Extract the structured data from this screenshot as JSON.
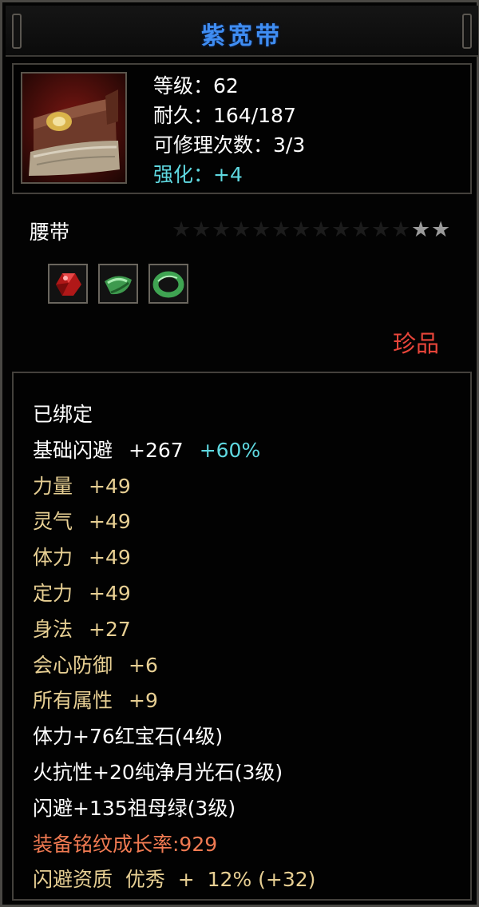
{
  "item": {
    "name": "紫宽带",
    "level_label": "等级：62",
    "durability_label": "耐久：164/187",
    "repair_label": "可修理次数：3/3",
    "enhance_label": "强化：+4",
    "type": "腰带",
    "stars_total": 14,
    "stars_lit": 2,
    "rarity": "珍品"
  },
  "icons": {
    "item_icon": "belt-icon",
    "gems": [
      "ruby-gem-icon",
      "jade-gem-icon",
      "emerald-ring-gem-icon"
    ]
  },
  "colors": {
    "title": "#3f8df2",
    "enhance": "#5fd8e0",
    "attribute": "#e7cf93",
    "rarity": "#e8453a",
    "growth": "#f07a52"
  },
  "attributes": {
    "bound": "已绑定",
    "base_dodge": {
      "label": "基础闪避",
      "value": "+267",
      "bonus": "+60%"
    },
    "stats": [
      {
        "label": "力量",
        "value": "+49"
      },
      {
        "label": "灵气",
        "value": "+49"
      },
      {
        "label": "体力",
        "value": "+49"
      },
      {
        "label": "定力",
        "value": "+49"
      },
      {
        "label": "身法",
        "value": "+27"
      },
      {
        "label": "会心防御",
        "value": "+6"
      },
      {
        "label": "所有属性",
        "value": "+9"
      }
    ],
    "gem_lines": [
      "体力+76红宝石(4级)",
      "火抗性+20纯净月光石(3级)",
      "闪避+135祖母绿(3级)"
    ],
    "growth": "装备铭纹成长率:929",
    "aptitude": "闪避资质  优秀  +  12% (+32)"
  }
}
